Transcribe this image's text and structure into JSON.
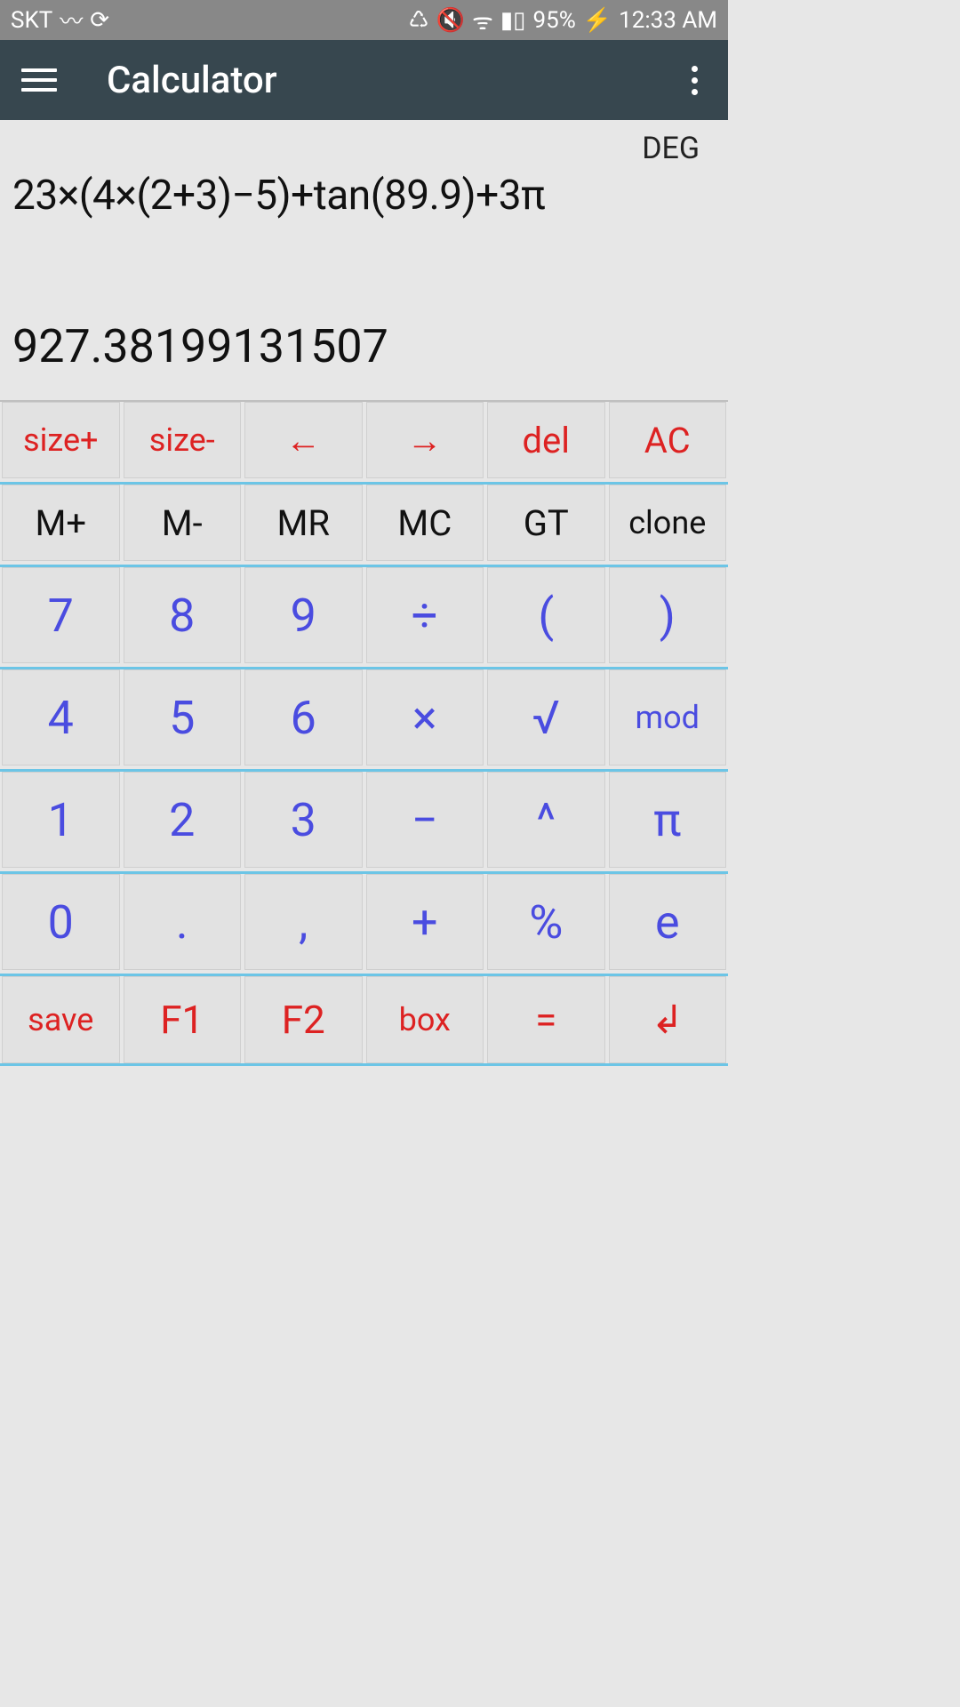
{
  "status_bar": {
    "carrier": "SKT",
    "battery_pct": "95%",
    "time": "12:33 AM"
  },
  "app_bar": {
    "title": "Calculator"
  },
  "display": {
    "mode": "DEG",
    "expression": "23×(4×(2+3)−5)+tan(89.9)+3π",
    "result": "927.38199131507"
  },
  "keys": {
    "row_top": [
      "size+",
      "size-",
      "←",
      "→",
      "del",
      "AC"
    ],
    "row_mem": [
      "M+",
      "M-",
      "MR",
      "MC",
      "GT",
      "clone"
    ],
    "row_789": [
      "7",
      "8",
      "9",
      "÷",
      "(",
      ")"
    ],
    "row_456": [
      "4",
      "5",
      "6",
      "×",
      "√",
      "mod"
    ],
    "row_123": [
      "1",
      "2",
      "3",
      "−",
      "^",
      "π"
    ],
    "row_0": [
      "0",
      ".",
      ",",
      "+",
      "%",
      "e"
    ],
    "row_bottom": [
      "save",
      "F1",
      "F2",
      "box",
      "=",
      "↲"
    ]
  }
}
